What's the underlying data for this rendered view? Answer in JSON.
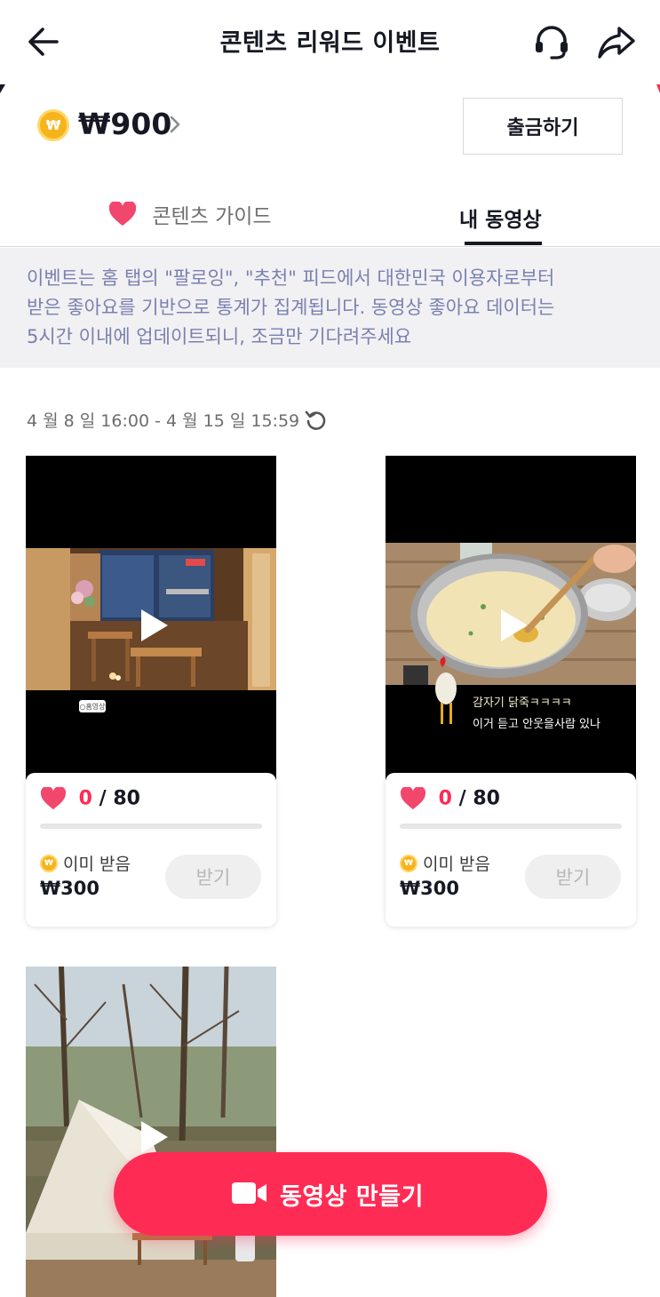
{
  "header": {
    "title": "콘텐츠 리워드 이벤트",
    "back_icon": "arrow-left-icon",
    "support_icon": "headset-icon",
    "share_icon": "share-arrow-icon"
  },
  "wallet": {
    "balance": "₩900",
    "coin_glyph": "₩",
    "withdraw_label": "출금하기"
  },
  "tabs": [
    {
      "label": "콘텐츠 가이드",
      "icon": "heart-icon",
      "active": false
    },
    {
      "label": "내 동영상",
      "active": true
    }
  ],
  "notice": {
    "line1": "이벤트는 홈 탭의 \"팔로잉\", \"추천\" 피드에서 대한민국 이용자로부터",
    "line2": "받은 좋아요를 기반으로 통계가 집계됩니다. 동영상 좋아요 데이터는",
    "line3": "5시간 이내에 업데이트되니, 조금만 기다려주세요"
  },
  "period": "4 월 8 일 16:00 - 4 월 15 일 15:59",
  "videos": [
    {
      "likes": "0",
      "likes_target": "/ 80",
      "likes_fraction": 0,
      "status": "이미 받음",
      "reward": "₩300",
      "claim_label": "받기",
      "thumb_caption": "○홈영상"
    },
    {
      "likes": "0",
      "likes_target": "/ 80",
      "likes_fraction": 0,
      "status": "이미 받음",
      "reward": "₩300",
      "claim_label": "받기",
      "thumb_caption_1": "감자기 닭죽ㅋㅋㅋㅋ",
      "thumb_caption_2": "이거 듣고 안웃을사람 있나"
    },
    {
      "thumb_caption": ""
    }
  ],
  "cta": {
    "label": "동영상 만들기",
    "icon": "video-camera-icon"
  },
  "colors": {
    "accent": "#fe2c55",
    "notice_text": "#7a80b0",
    "notice_bg": "#f1f1f3",
    "coin": "#f6b41c"
  }
}
